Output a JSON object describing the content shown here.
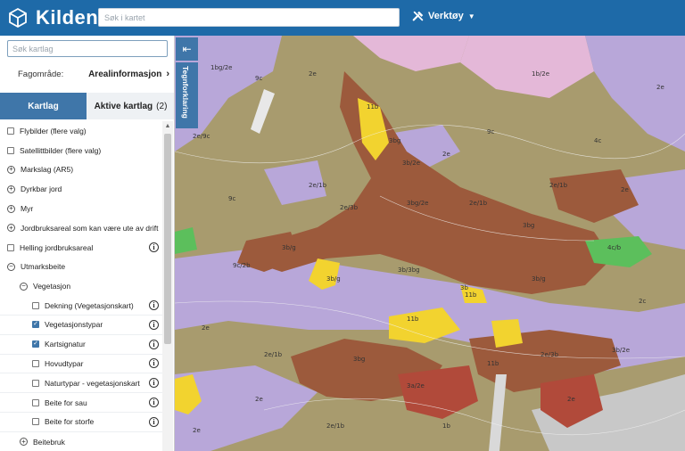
{
  "header": {
    "app_title": "Kilden",
    "search_placeholder": "Søk i kartet",
    "tools_label": "Verktøy"
  },
  "sidebar": {
    "layer_search_placeholder": "Søk kartlag",
    "fagomrade_label": "Fagområde:",
    "fagomrade_value": "Arealinformasjon",
    "tabs": {
      "kartlag": "Kartlag",
      "aktive": "Aktive kartlag",
      "aktive_count": "(2)"
    },
    "layers": [
      {
        "label": "Flybilder (flere valg)",
        "type": "checkbox",
        "checked": false,
        "info": false
      },
      {
        "label": "Satellittbilder (flere valg)",
        "type": "checkbox",
        "checked": false,
        "info": false
      },
      {
        "label": "Markslag (AR5)",
        "type": "group",
        "expanded": false,
        "info": false
      },
      {
        "label": "Dyrkbar jord",
        "type": "group",
        "expanded": false,
        "info": false
      },
      {
        "label": "Myr",
        "type": "group",
        "expanded": false,
        "info": false
      },
      {
        "label": "Jordbruksareal som kan være ute av drift",
        "type": "group",
        "expanded": false,
        "info": false
      },
      {
        "label": "Helling jordbruksareal",
        "type": "checkbox",
        "checked": false,
        "info": true
      },
      {
        "label": "Utmarksbeite",
        "type": "group",
        "expanded": true,
        "info": false
      },
      {
        "label": "Vegetasjon",
        "type": "group",
        "expanded": true,
        "info": false
      },
      {
        "label": "Dekning (Vegetasjonskart)",
        "type": "checkbox",
        "checked": false,
        "info": true
      },
      {
        "label": "Vegetasjonstypar",
        "type": "checkbox",
        "checked": true,
        "info": true
      },
      {
        "label": "Kartsignatur",
        "type": "checkbox",
        "checked": true,
        "info": true
      },
      {
        "label": "Hovudtypar",
        "type": "checkbox",
        "checked": false,
        "info": true
      },
      {
        "label": "Naturtypar - vegetasjonskart",
        "type": "checkbox",
        "checked": false,
        "info": true
      },
      {
        "label": "Beite for sau",
        "type": "checkbox",
        "checked": false,
        "info": true
      },
      {
        "label": "Beite for storfe",
        "type": "checkbox",
        "checked": false,
        "info": true
      },
      {
        "label": "Beitebruk",
        "type": "group",
        "expanded": false,
        "info": false
      }
    ]
  },
  "map": {
    "legend_tab_label": "Tegnforklaring",
    "colors": {
      "brown": "#9c5a3c",
      "dark_red": "#b14a3a",
      "olive": "#a89b6e",
      "lilac": "#b8a7d9",
      "pink": "#e4b8d8",
      "yellow": "#f2d32f",
      "green": "#5cbf5c",
      "grey": "#c8c8c8"
    },
    "labels": [
      "2e",
      "1b",
      "9c",
      "3b",
      "11b",
      "2e/1b",
      "2e/9c",
      "3b/g",
      "2e/3b",
      "3b/2e",
      "1b/2e",
      "2c",
      "4c",
      "2e/3b",
      "4c/b"
    ]
  },
  "colors": {
    "header_bg": "#1e6aa8",
    "accent": "#3f76a9"
  }
}
